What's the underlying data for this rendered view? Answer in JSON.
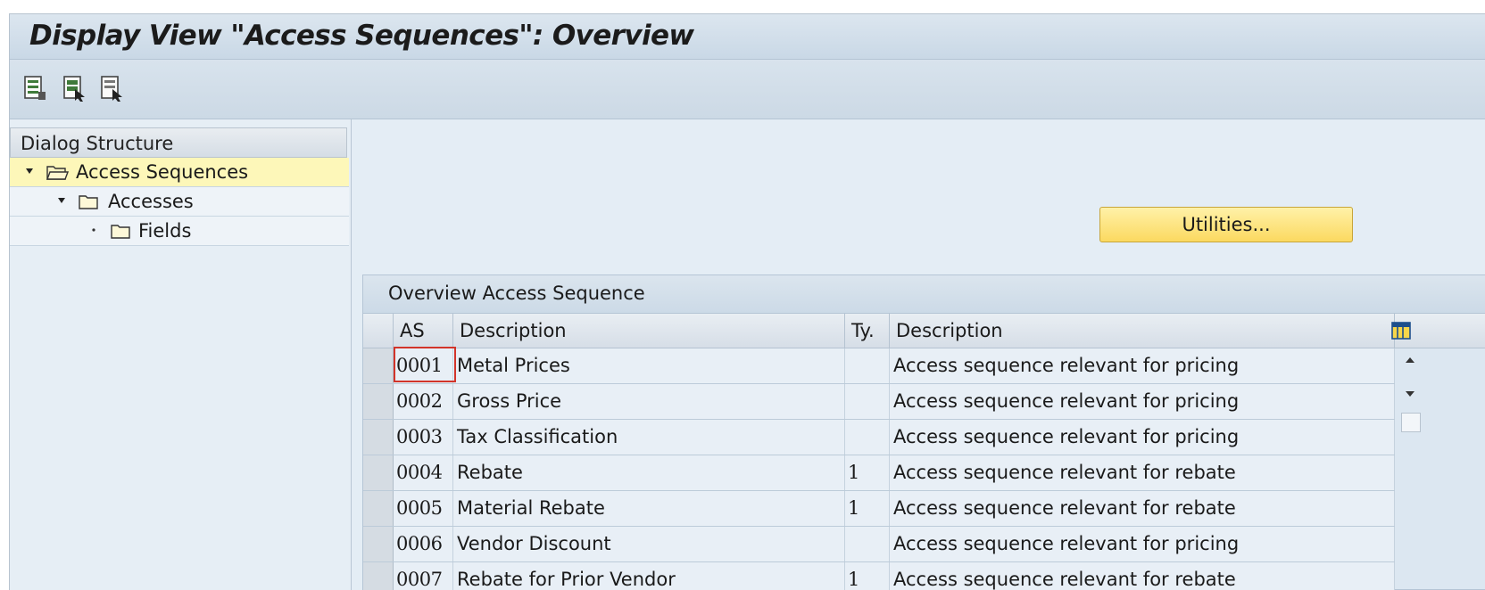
{
  "title": "Display View \"Access Sequences\": Overview",
  "toolbar": {
    "buttons": [
      "details-icon",
      "select-all-icon",
      "deselect-all-icon"
    ]
  },
  "dialog_structure": {
    "header": "Dialog Structure",
    "nodes": [
      {
        "label": "Access Sequences",
        "level": 0,
        "expanded": true,
        "selected": true,
        "icon": "open-folder-icon"
      },
      {
        "label": "Accesses",
        "level": 1,
        "expanded": true,
        "selected": false,
        "icon": "folder-icon"
      },
      {
        "label": "Fields",
        "level": 2,
        "expanded": false,
        "selected": false,
        "icon": "folder-icon"
      }
    ]
  },
  "utilities_button": "Utilities...",
  "overview": {
    "title": "Overview Access Sequence",
    "columns": [
      "AS",
      "Description",
      "Ty.",
      "Description"
    ],
    "rows": [
      {
        "as": "0001",
        "description": "Metal Prices",
        "type": "",
        "type_description": "Access sequence relevant for pricing"
      },
      {
        "as": "0002",
        "description": "Gross Price",
        "type": "",
        "type_description": "Access sequence relevant for pricing"
      },
      {
        "as": "0003",
        "description": "Tax Classification",
        "type": "",
        "type_description": "Access sequence relevant for pricing"
      },
      {
        "as": "0004",
        "description": "Rebate",
        "type": "1",
        "type_description": "Access sequence relevant for rebate"
      },
      {
        "as": "0005",
        "description": "Material Rebate",
        "type": "1",
        "type_description": "Access sequence relevant for rebate"
      },
      {
        "as": "0006",
        "description": "Vendor Discount",
        "type": "",
        "type_description": "Access sequence relevant for pricing"
      },
      {
        "as": "0007",
        "description": "Rebate for Prior Vendor",
        "type": "1",
        "type_description": "Access sequence relevant for rebate"
      }
    ]
  },
  "colors": {
    "selection_yellow": "#fdf7b9",
    "button_yellow": "#fbd960",
    "focus_red": "#d2342a"
  }
}
